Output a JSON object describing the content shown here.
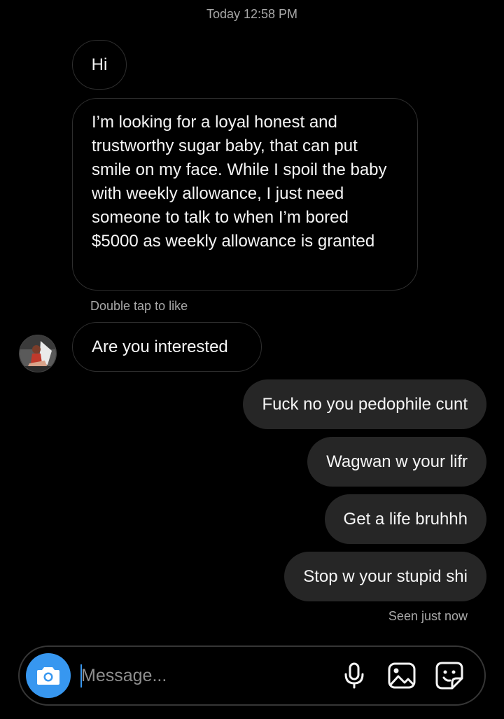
{
  "thread": {
    "timestamp": "Today 12:58 PM",
    "incoming": [
      {
        "text": "Hi"
      },
      {
        "text": "I’m looking for a loyal honest and trustworthy sugar baby, that can put smile on my face. While I spoil the baby with weekly allowance, I just need someone to talk to when I’m bored $5000 as weekly allowance is granted"
      },
      {
        "text": "Are you interested"
      }
    ],
    "like_hint": "Double tap to like",
    "outgoing": [
      {
        "text": "Fuck no you pedophile cunt"
      },
      {
        "text": "Wagwan w your lifr"
      },
      {
        "text": "Get a life bruhhh"
      },
      {
        "text": "Stop w your stupid shi"
      }
    ],
    "seen_status": "Seen just now"
  },
  "composer": {
    "placeholder": "Message...",
    "value": "",
    "icons": {
      "camera": "camera-icon",
      "mic": "microphone-icon",
      "gallery": "gallery-icon",
      "sticker": "sticker-icon"
    }
  },
  "colors": {
    "background": "#000000",
    "outgoing_bubble": "#262626",
    "accent": "#3797f0",
    "muted_text": "#a8a8a8"
  }
}
